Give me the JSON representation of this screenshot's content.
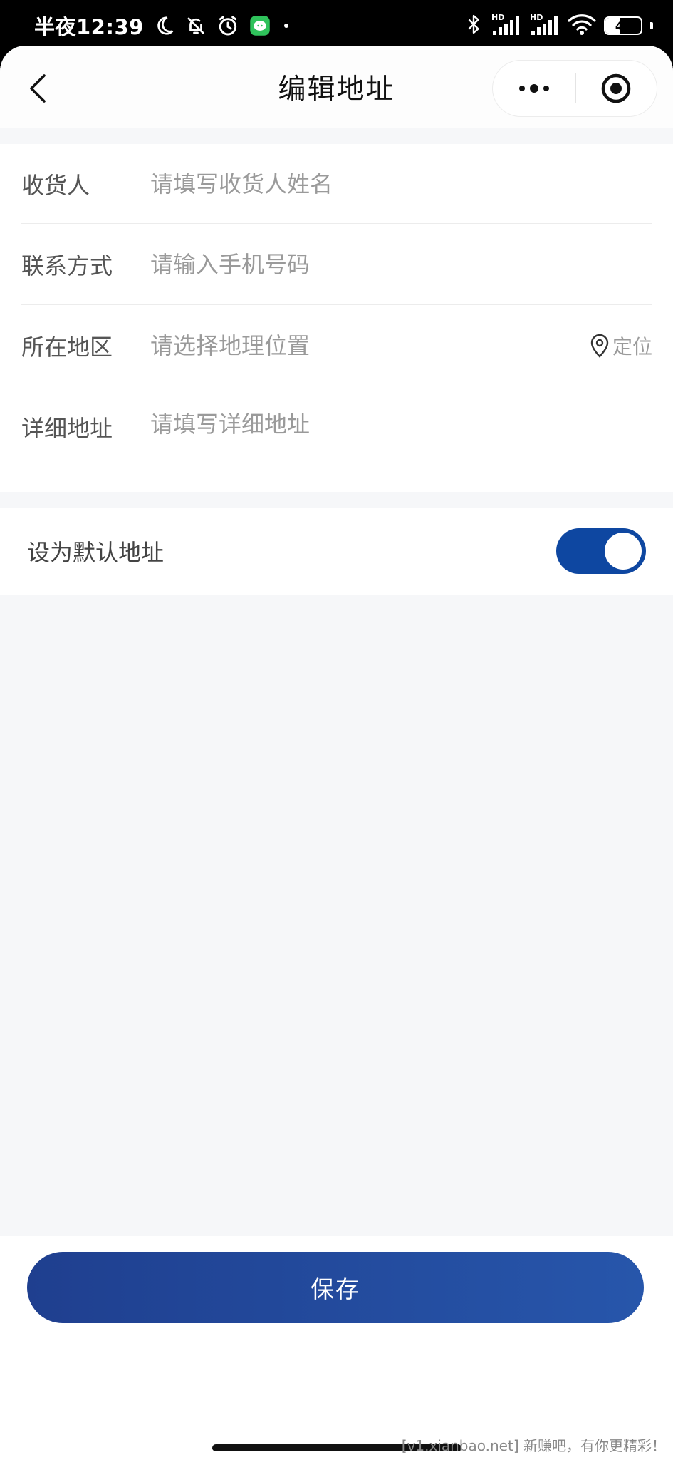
{
  "status_bar": {
    "time": "半夜12:39",
    "battery": "41",
    "battery_level": 0.41
  },
  "nav": {
    "title": "编辑地址",
    "back_icon": "chevron-left-icon",
    "more_icon": "more-dots-icon",
    "close_icon": "target-close-icon"
  },
  "form": {
    "receiver": {
      "label": "收货人",
      "placeholder": "请填写收货人姓名",
      "value": ""
    },
    "phone": {
      "label": "联系方式",
      "placeholder": "请输入手机号码",
      "value": ""
    },
    "region": {
      "label": "所在地区",
      "placeholder": "请选择地理位置",
      "value": "",
      "locate_label": "定位"
    },
    "detail": {
      "label": "详细地址",
      "placeholder": "请填写详细地址",
      "value": ""
    }
  },
  "default_address": {
    "label": "设为默认地址",
    "enabled": true
  },
  "actions": {
    "save_label": "保存"
  },
  "watermark": "[v1.xianbao.net] 新赚吧，有你更精彩！",
  "colors": {
    "accent": "#0e47a1",
    "button_start": "#1f3f8f",
    "button_end": "#2756ab",
    "page_background": "#f6f7f9"
  }
}
